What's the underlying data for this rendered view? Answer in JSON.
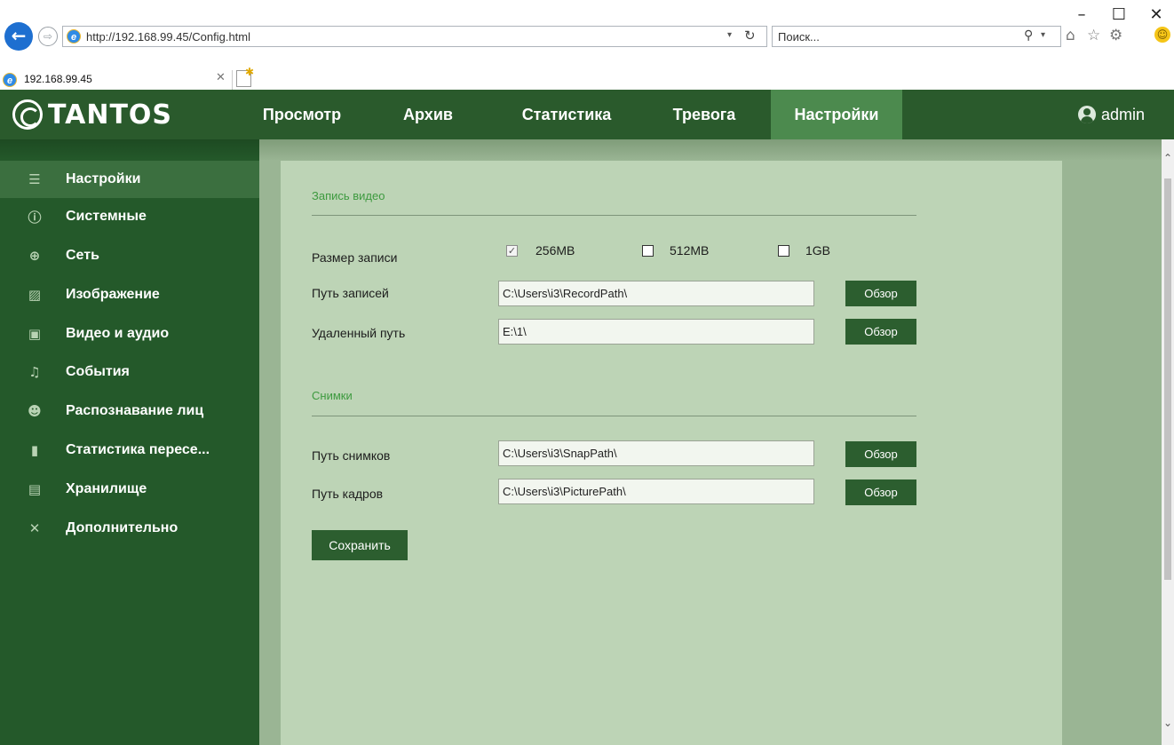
{
  "window": {
    "minimize_glyph": "–",
    "maximize_glyph": "☐",
    "close_glyph": "✕"
  },
  "browser": {
    "url": "http://192.168.99.45/Config.html",
    "search_placeholder": "Поиск...",
    "tab_title": "192.168.99.45",
    "icons": [
      "back-arrow-icon",
      "forward-arrow-icon",
      "ie-icon",
      "refresh-icon",
      "search-icon",
      "home-icon",
      "star-icon",
      "gear-icon",
      "smiley-icon"
    ]
  },
  "header": {
    "logo_text": "TANTOS",
    "nav": [
      {
        "label": "Просмотр",
        "active": false
      },
      {
        "label": "Архив",
        "active": false
      },
      {
        "label": "Статистика",
        "active": false
      },
      {
        "label": "Тревога",
        "active": false
      },
      {
        "label": "Настройки",
        "active": true
      }
    ],
    "user": "admin"
  },
  "sidebar": {
    "items": [
      {
        "label": "Настройки",
        "icon": "list-icon",
        "active": true
      },
      {
        "label": "Системные",
        "icon": "info-icon"
      },
      {
        "label": "Сеть",
        "icon": "globe-icon"
      },
      {
        "label": "Изображение",
        "icon": "image-icon"
      },
      {
        "label": "Видео и аудио",
        "icon": "video-icon"
      },
      {
        "label": "События",
        "icon": "bell-icon"
      },
      {
        "label": "Распознавание лиц",
        "icon": "face-icon"
      },
      {
        "label": "Статистика пересе...",
        "icon": "bar-chart-icon"
      },
      {
        "label": "Хранилище",
        "icon": "save-icon"
      },
      {
        "label": "Дополнительно",
        "icon": "tools-icon"
      }
    ]
  },
  "record_section": {
    "title": "Запись видео",
    "size_label": "Размер записи",
    "size_options": [
      {
        "label": "256MB",
        "checked": true
      },
      {
        "label": "512MB",
        "checked": false
      },
      {
        "label": "1GB",
        "checked": false
      }
    ],
    "record_path_label": "Путь записей",
    "record_path_value": "C:\\Users\\i3\\RecordPath\\",
    "remote_path_label": "Удаленный путь",
    "remote_path_value": "E:\\1\\"
  },
  "snap_section": {
    "title": "Снимки",
    "snap_path_label": "Путь снимков",
    "snap_path_value": "C:\\Users\\i3\\SnapPath\\",
    "picture_path_label": "Путь кадров",
    "picture_path_value": "C:\\Users\\i3\\PicturePath\\"
  },
  "buttons": {
    "browse": "Обзор",
    "save": "Сохранить"
  },
  "colors": {
    "header_bg": "#2a5a2c",
    "nav_active_bg": "#4c8a4e",
    "sidebar_bg": "#24592a",
    "panel_bg": "#bdd4b6",
    "section_title": "#3d9a3f",
    "button_bg": "#2c5e2f"
  }
}
